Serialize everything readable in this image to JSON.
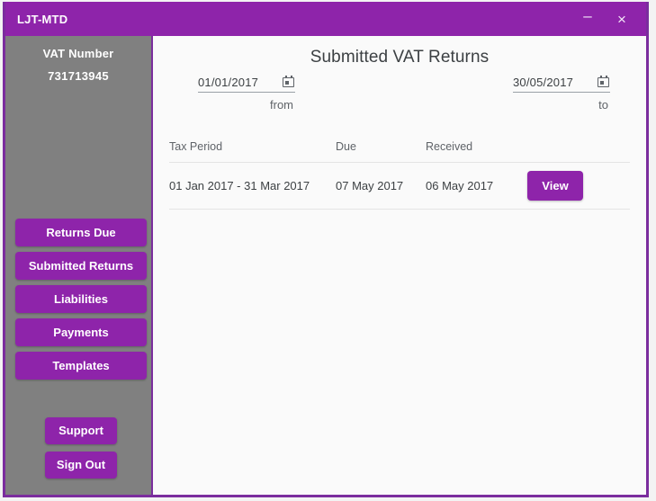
{
  "window": {
    "title": "LJT-MTD",
    "controls": {
      "minimize": "–",
      "close": "×"
    },
    "accent_color": "#8e24aa",
    "border_color": "#7b2d9e",
    "sidebar_color": "#808080"
  },
  "sidebar": {
    "vat_label": "VAT Number",
    "vat_number": "731713945",
    "items": [
      {
        "label": "Returns Due"
      },
      {
        "label": "Submitted Returns"
      },
      {
        "label": "Liabilities"
      },
      {
        "label": "Payments"
      },
      {
        "label": "Templates"
      }
    ],
    "bottom_items": [
      {
        "label": "Support"
      },
      {
        "label": "Sign Out"
      }
    ]
  },
  "main": {
    "title": "Submitted VAT Returns",
    "filters": {
      "from": {
        "value": "01/01/2017",
        "caption": "from",
        "icon": "calendar-icon"
      },
      "to": {
        "value": "30/05/2017",
        "caption": "to",
        "icon": "calendar-icon"
      }
    },
    "table": {
      "headers": {
        "period": "Tax Period",
        "due": "Due",
        "received": "Received"
      },
      "rows": [
        {
          "period": "01 Jan 2017 - 31 Mar 2017",
          "due": "07 May 2017",
          "received": "06 May 2017",
          "action": "View"
        }
      ]
    }
  }
}
